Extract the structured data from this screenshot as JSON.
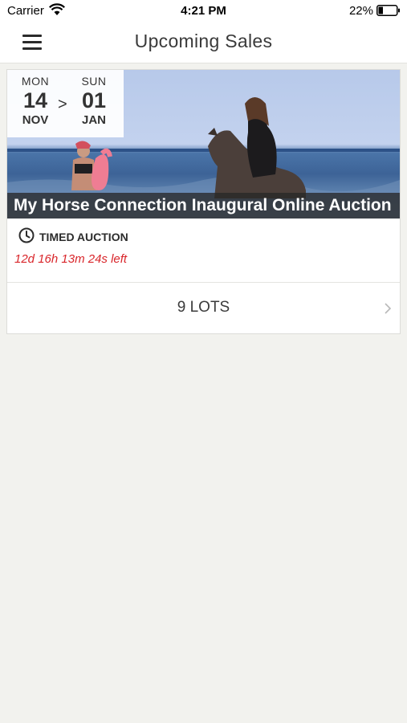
{
  "status_bar": {
    "carrier": "Carrier",
    "time": "4:21 PM",
    "battery_percent": "22%",
    "icons": [
      "wifi-icon",
      "battery-icon"
    ]
  },
  "nav": {
    "title": "Upcoming Sales",
    "menu_icon": "hamburger-menu-icon"
  },
  "sale": {
    "start": {
      "day_of_week": "MON",
      "day": "14",
      "month": "NOV"
    },
    "separator": ">",
    "end": {
      "day_of_week": "SUN",
      "day": "01",
      "month": "JAN"
    },
    "title": "My Horse Connection Inaugural Online Auction",
    "type": "TIMED AUCTION",
    "time_left": "12d 16h 13m 24s left",
    "lots_label": "9 LOTS",
    "accent_color": "#d9262b"
  }
}
